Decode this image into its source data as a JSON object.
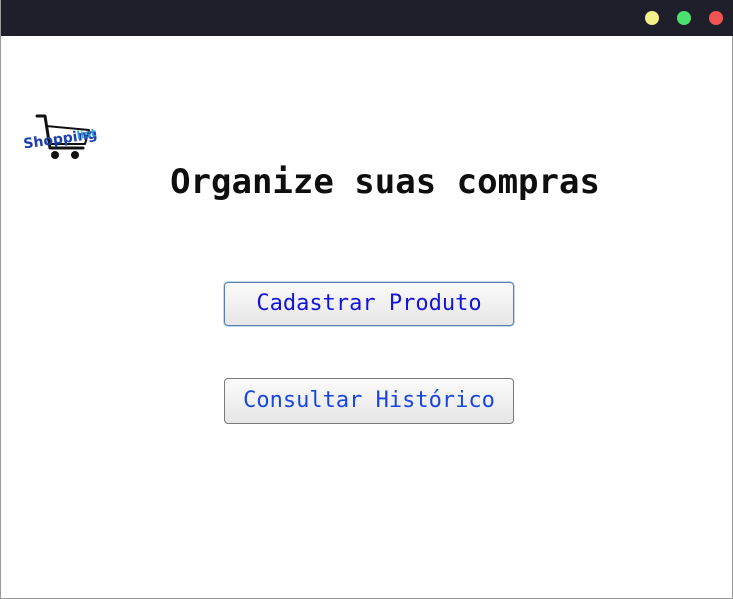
{
  "window": {
    "controls": [
      {
        "name": "minimize-button",
        "color": "#f4f08a"
      },
      {
        "name": "maximize-button",
        "color": "#4ce16f"
      },
      {
        "name": "close-button",
        "color": "#f25454"
      }
    ]
  },
  "logo": {
    "text": "Shoppinglist",
    "icon": "shopping-cart-icon",
    "colors": {
      "cart": "#111111",
      "text_primary": "#1c3fae",
      "text_secondary": "#3b9ad9"
    }
  },
  "main": {
    "title": "Organize suas compras",
    "buttons": {
      "register_label": "Cadastrar Produto",
      "history_label": "Consultar Histórico"
    },
    "colors": {
      "button_text": "#1414dd",
      "button_text_2": "#1a46e0"
    }
  }
}
